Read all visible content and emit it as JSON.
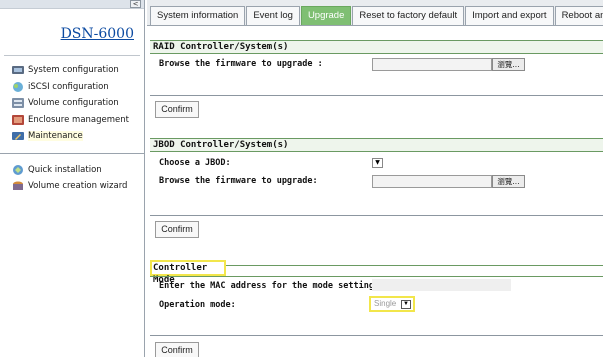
{
  "sidebar": {
    "collapse_glyph": "<",
    "brand": "DSN-6000",
    "items": [
      {
        "label": "System configuration",
        "icon": "system-configuration-icon"
      },
      {
        "label": "iSCSI configuration",
        "icon": "iscsi-configuration-icon"
      },
      {
        "label": "Volume configuration",
        "icon": "volume-configuration-icon"
      },
      {
        "label": "Enclosure management",
        "icon": "enclosure-management-icon"
      },
      {
        "label": "Maintenance",
        "icon": "maintenance-icon",
        "active": true
      }
    ],
    "quick_items": [
      {
        "label": "Quick installation",
        "icon": "quick-installation-icon"
      },
      {
        "label": "Volume creation wizard",
        "icon": "volume-creation-wizard-icon"
      }
    ]
  },
  "tabs": [
    {
      "label": "System information"
    },
    {
      "label": "Event log"
    },
    {
      "label": "Upgrade",
      "active": true
    },
    {
      "label": "Reset to factory default"
    },
    {
      "label": "Import and export"
    },
    {
      "label": "Reboot and shutdown"
    }
  ],
  "raid": {
    "title": "RAID Controller/System(s)",
    "browse_label": "Browse the firmware to upgrade :",
    "browse_button": "瀏覽...",
    "confirm": "Confirm"
  },
  "jbod": {
    "title": "JBOD Controller/System(s)",
    "choose_label": "Choose a JBOD:",
    "browse_label": "Browse the firmware to upgrade:",
    "browse_button": "瀏覽...",
    "confirm": "Confirm"
  },
  "controller_mode": {
    "title": "Controller Mode",
    "mac_label": "Enter the MAC address for the mode setting:",
    "mac_value": "",
    "operation_label": "Operation mode:",
    "operation_value": "Single",
    "confirm": "Confirm"
  },
  "colors": {
    "active_tab": "#7fbf73",
    "brand_link": "#0b4aa1",
    "highlight": "#f2e64b",
    "section_line": "#6a9a62"
  }
}
